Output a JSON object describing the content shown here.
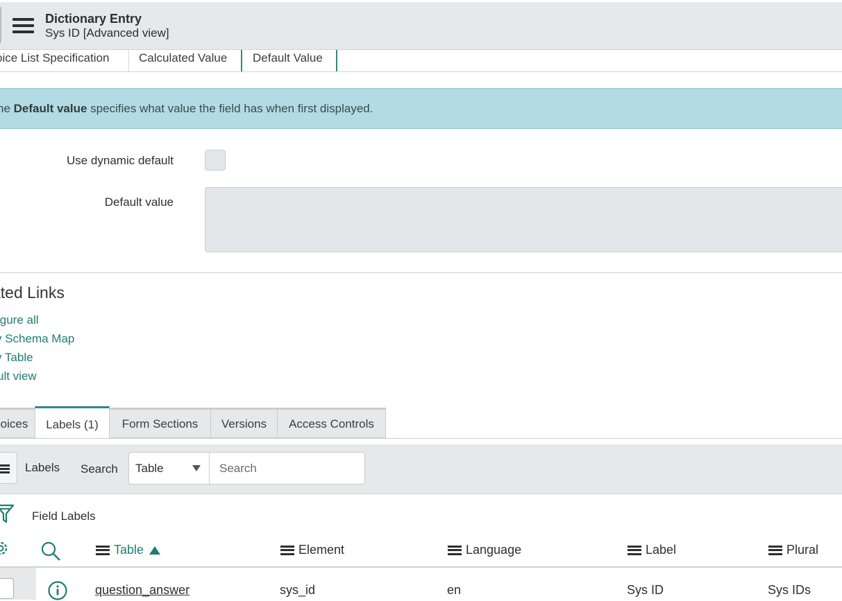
{
  "header": {
    "title": "Dictionary Entry",
    "subtitle": "Sys ID [Advanced view]"
  },
  "top_tabs": [
    {
      "label": "oice List Specification"
    },
    {
      "label": "Calculated Value"
    },
    {
      "label": "Default Value"
    }
  ],
  "banner": {
    "prefix": "he ",
    "bold": "Default value",
    "suffix": " specifies what value the field has when first displayed."
  },
  "form": {
    "dynamic_default_label": "Use dynamic default",
    "dynamic_default_checked": false,
    "default_value_label": "Default value",
    "default_value": ""
  },
  "related_links": {
    "title": "ated Links",
    "links": [
      "igure all",
      "v Schema Map",
      "v Table",
      "ult view"
    ]
  },
  "related_tabs": [
    {
      "label": "oices"
    },
    {
      "label": "Labels (1)"
    },
    {
      "label": "Form Sections"
    },
    {
      "label": "Versions"
    },
    {
      "label": "Access Controls"
    }
  ],
  "list_toolbar": {
    "title": "Labels",
    "search_label": "Search",
    "search_field": "Table",
    "search_placeholder": "Search"
  },
  "filter": {
    "breadcrumb": "Field Labels"
  },
  "table": {
    "columns": [
      "Table",
      "Element",
      "Language",
      "Label",
      "Plural"
    ],
    "sorted_column": "Table",
    "sort_direction": "ascending",
    "rows": [
      {
        "table": "question_answer",
        "element": "sys_id",
        "language": "en",
        "label": "Sys ID",
        "plural": "Sys IDs"
      }
    ]
  },
  "colors": {
    "accent": "#2e8b7e",
    "link": "#1f7d70",
    "banner_bg": "#b2dbe3",
    "header_bg": "#e6e8ea"
  }
}
